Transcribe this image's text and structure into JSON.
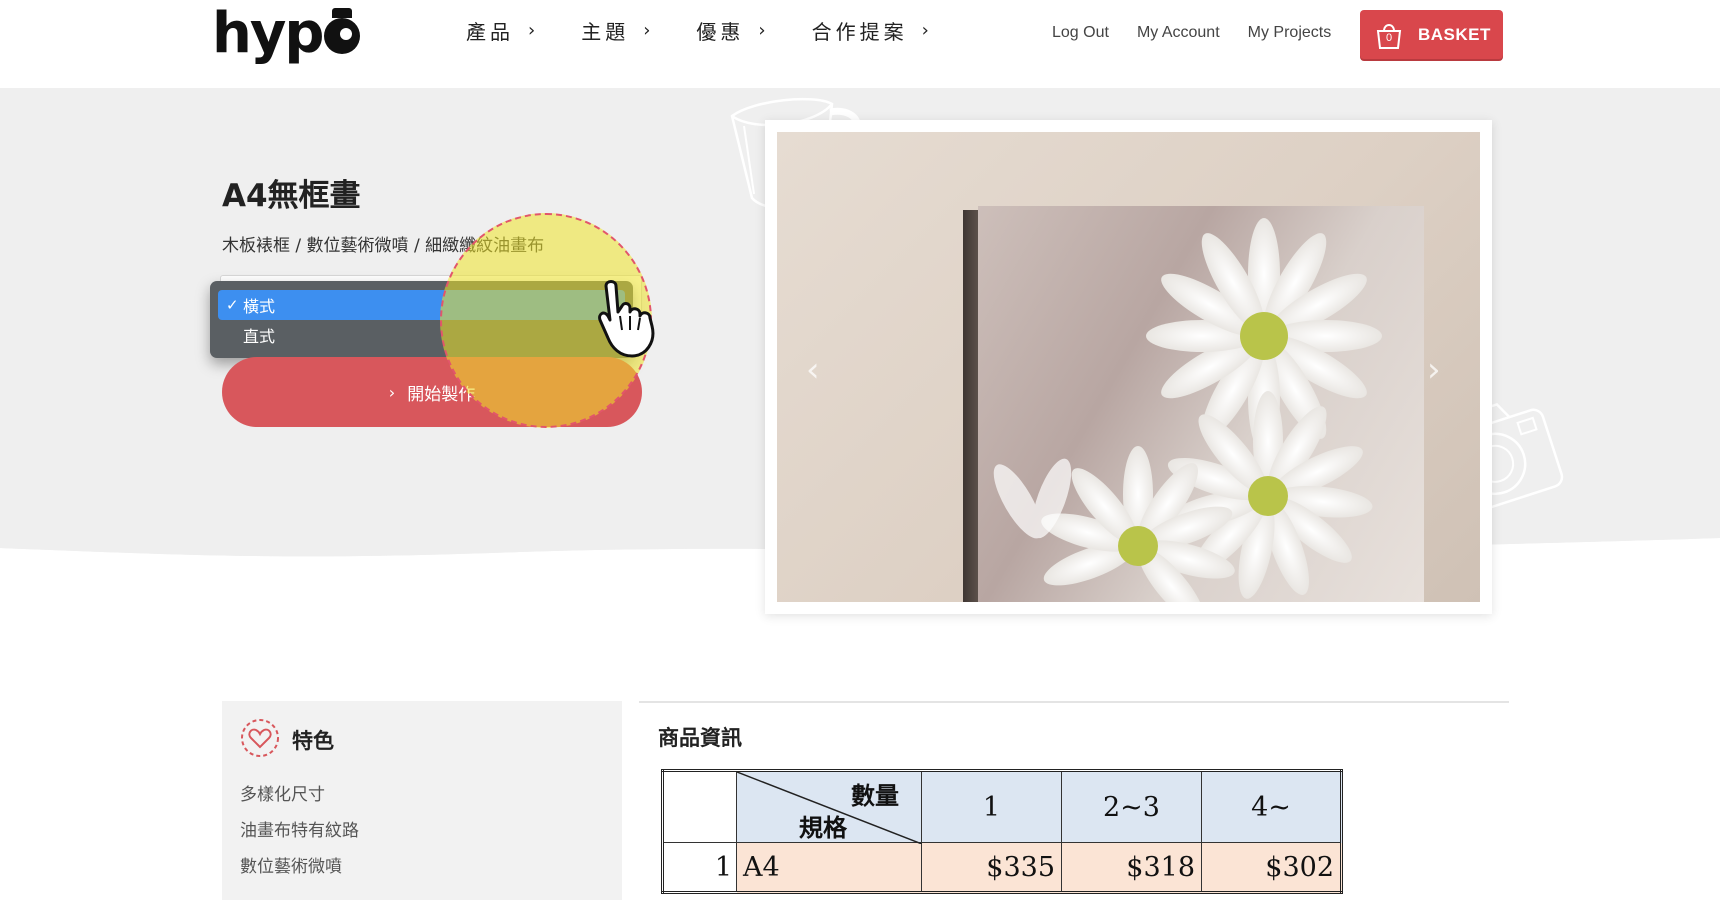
{
  "header": {
    "logo": "hyp",
    "nav": [
      {
        "label": "產品"
      },
      {
        "label": "主題"
      },
      {
        "label": "優惠"
      },
      {
        "label": "合作提案"
      }
    ],
    "account_links": [
      "Log Out",
      "My Account",
      "My Projects"
    ],
    "basket": {
      "label": "BASKET",
      "count": "0"
    }
  },
  "product": {
    "title": "A4無框畫",
    "subtitle": "木板裱框 / 數位藝術微噴 / 細緻纖紋油畫布",
    "orientation_options": [
      {
        "label": "橫式",
        "selected": true
      },
      {
        "label": "直式",
        "selected": false
      }
    ],
    "start_button": "開始製作"
  },
  "features": {
    "title": "特色",
    "items": [
      "多樣化尺寸",
      "油畫布特有紋路",
      "數位藝術微噴"
    ]
  },
  "product_info": {
    "title": "商品資訊",
    "table": {
      "corner_top": "數量",
      "corner_bottom": "規格",
      "quantity_headers": [
        "1",
        "2~3",
        "4~"
      ],
      "rows": [
        {
          "num": "1",
          "spec": "A4",
          "prices": [
            "$335",
            "$318",
            "$302"
          ]
        }
      ]
    }
  },
  "colors": {
    "accent": "#d8575c",
    "basket": "#d9474c",
    "dropdown_selected": "#3d8ff0",
    "table_header": "#dce6f2",
    "table_cell": "#fbe4d5"
  },
  "icons": {
    "basket": "shopping-bag-icon",
    "features": "heart-icon",
    "cursor": "hand-pointer-icon"
  }
}
